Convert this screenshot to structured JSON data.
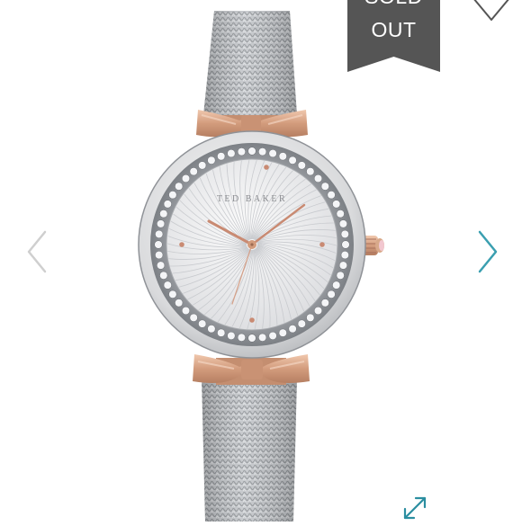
{
  "badge": {
    "line1": "SOLD",
    "line2": "OUT"
  },
  "product": {
    "dial_brand": "TED BAKER"
  },
  "icons": {
    "favorite": "heart-outline-icon",
    "previous": "chevron-left-icon",
    "next": "chevron-right-icon",
    "fullscreen": "expand-arrows-icon"
  },
  "colors": {
    "badge_bg": "#555555",
    "arrow_prev": "#cfcfcf",
    "arrow_next": "#3a9fb0",
    "expand_icon": "#2b8ea0",
    "rose_gold": "#d9a98c",
    "steel": "#b9bcc0"
  }
}
